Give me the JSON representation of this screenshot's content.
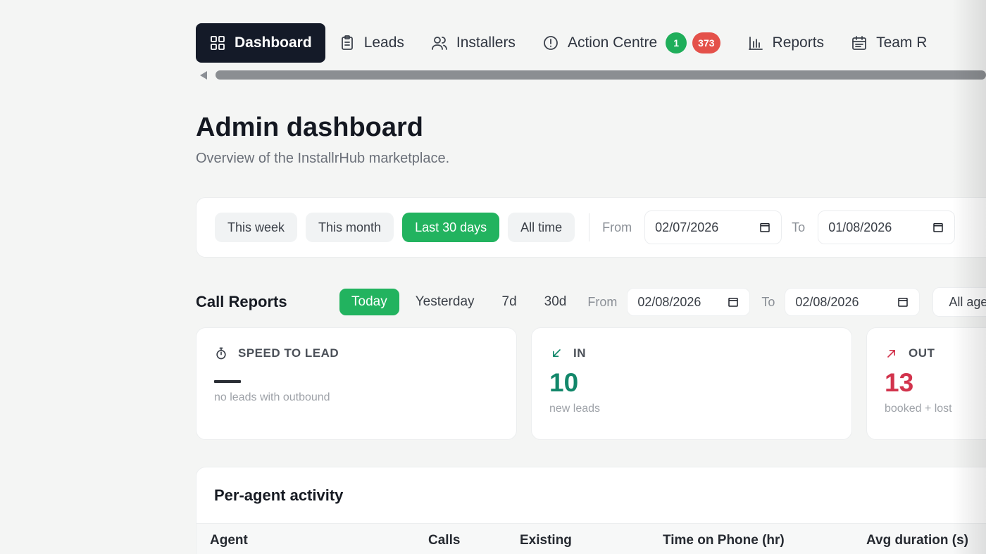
{
  "nav": {
    "items": [
      {
        "label": "Dashboard",
        "icon": "grid-icon",
        "active": true
      },
      {
        "label": "Leads",
        "icon": "clipboard-icon"
      },
      {
        "label": "Installers",
        "icon": "users-icon"
      },
      {
        "label": "Action Centre",
        "icon": "alert-circle-icon",
        "badges": [
          "1",
          "373"
        ]
      },
      {
        "label": "Reports",
        "icon": "bar-chart-icon"
      },
      {
        "label": "Team R",
        "icon": "calendar-icon"
      }
    ]
  },
  "page": {
    "title": "Admin dashboard",
    "subtitle": "Overview of the InstallrHub marketplace."
  },
  "filters": {
    "ranges": [
      "This week",
      "This month",
      "Last 30 days",
      "All time"
    ],
    "active_range": "Last 30 days",
    "from_label": "From",
    "from_value": "02/07/2026",
    "to_label": "To",
    "to_value": "01/08/2026"
  },
  "call_reports": {
    "title": "Call Reports",
    "ranges": [
      "Today",
      "Yesterday",
      "7d",
      "30d"
    ],
    "active_range": "Today",
    "from_label": "From",
    "from_value": "02/08/2026",
    "to_label": "To",
    "to_value": "02/08/2026",
    "agent_select": "All age"
  },
  "stats": {
    "speed": {
      "label": "SPEED TO LEAD",
      "note": "no leads with outbound"
    },
    "in": {
      "label": "IN",
      "value": "10",
      "note": "new leads",
      "color": "#12876a"
    },
    "out": {
      "label": "OUT",
      "value": "13",
      "note": "booked + lost",
      "color": "#d2334c"
    }
  },
  "agent_activity": {
    "title": "Per-agent activity",
    "columns": [
      "Agent",
      "Calls",
      "Existing",
      "Time on Phone (hr)",
      "Avg duration (s)"
    ]
  },
  "colors": {
    "nav_active_bg": "#141a28",
    "accent_green": "#22b35f",
    "badge_red": "#e4514a"
  }
}
